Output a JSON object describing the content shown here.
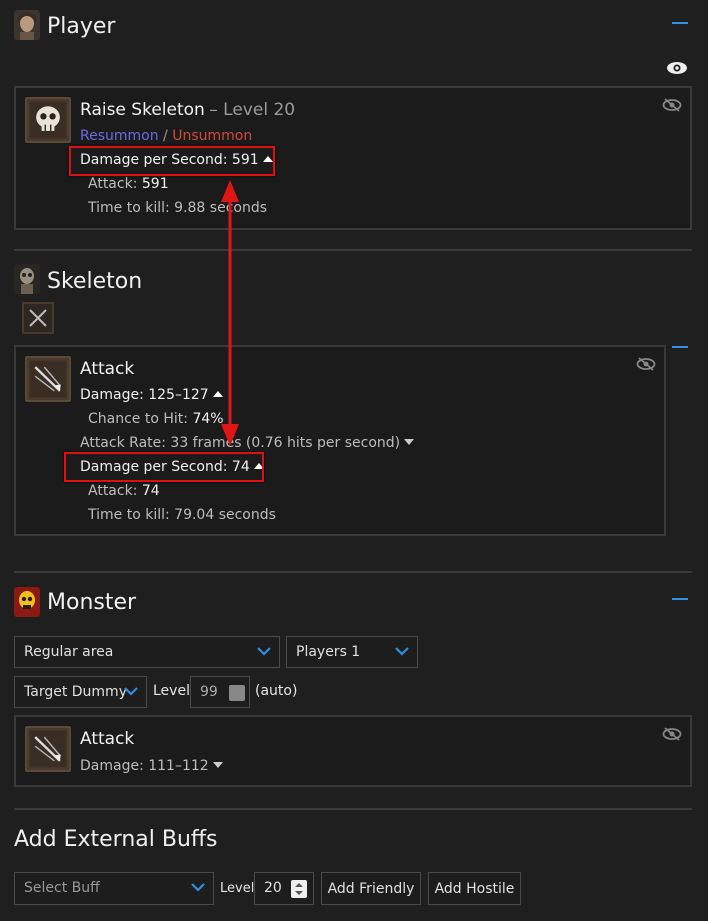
{
  "player": {
    "title": "Player",
    "skill": {
      "name": "Raise Skeleton",
      "level_text": "– Level 20",
      "resummon": "Resummon",
      "sep": "/",
      "unsummon": "Unsummon",
      "dps": "Damage per Second: 591",
      "attack_label": "Attack:",
      "attack_value": "591",
      "ttk_label": "Time to kill:",
      "ttk_value": "9.88 seconds"
    }
  },
  "skeleton": {
    "title": "Skeleton",
    "attack": {
      "name": "Attack",
      "damage": "Damage: 125–127",
      "cth_label": "Chance to Hit:",
      "cth_value": "74%",
      "attack_rate": "Attack Rate: 33 frames (0.76 hits per second)",
      "dps": "Damage per Second: 74",
      "attack_label": "Attack:",
      "attack_value": "74",
      "ttk_label": "Time to kill:",
      "ttk_value": "79.04 seconds"
    }
  },
  "monster": {
    "title": "Monster",
    "area_select": "Regular area",
    "players_select": "Players 1",
    "monster_select": "Target Dummy",
    "level_label": "Level",
    "level_value": "99",
    "auto_label": "(auto)",
    "attack": {
      "name": "Attack",
      "damage": "Damage: 111–112"
    }
  },
  "buffs": {
    "title": "Add External Buffs",
    "select_placeholder": "Select Buff",
    "level_label": "Level",
    "level_value": "20",
    "add_friendly": "Add Friendly",
    "add_hostile": "Add Hostile"
  },
  "colors": {
    "accent": "#2f8fe0",
    "resummon": "#6a6ae6",
    "unsummon": "#d04a3a",
    "highlight": "#dd1111"
  }
}
